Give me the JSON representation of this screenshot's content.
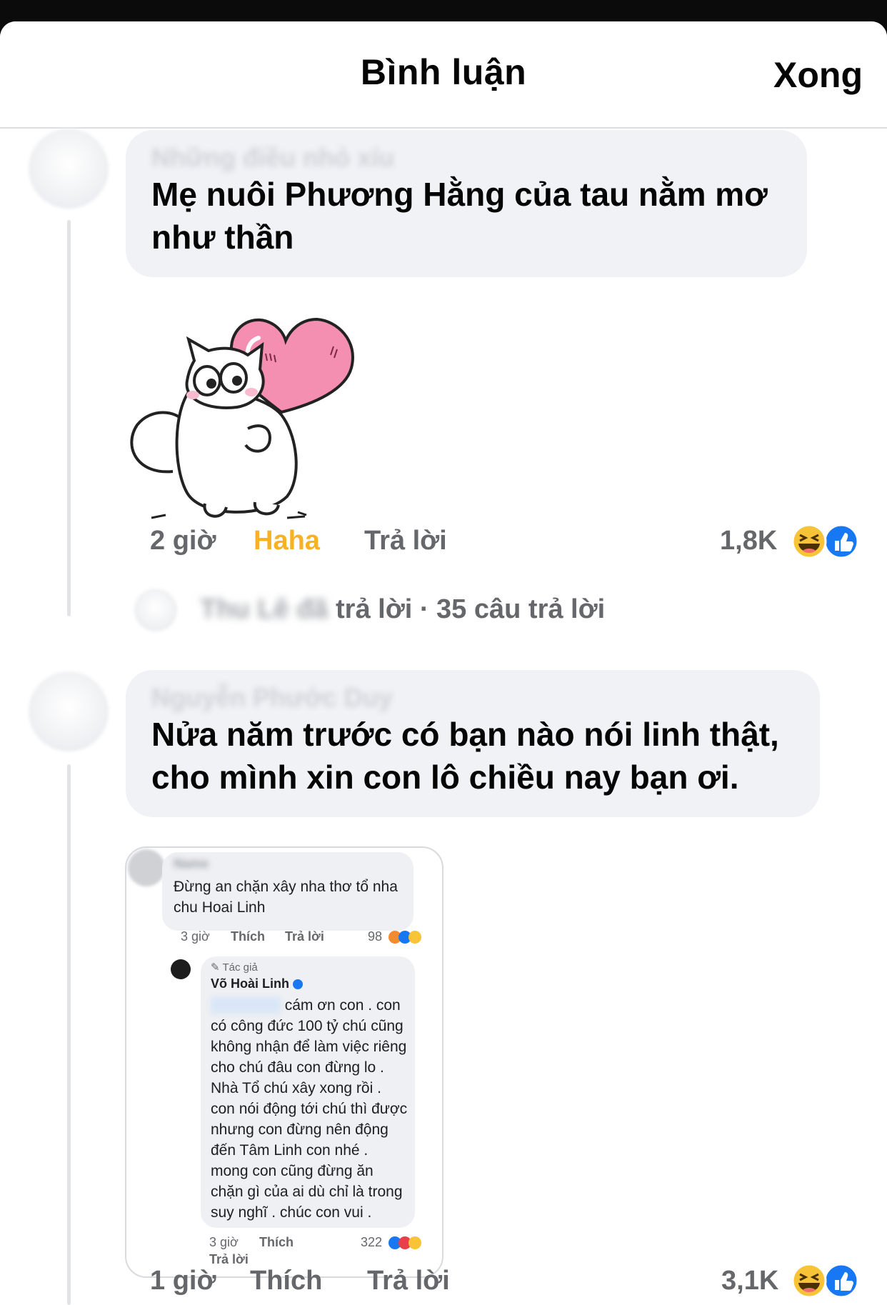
{
  "header": {
    "title": "Bình luận",
    "done_label": "Xong"
  },
  "comments": [
    {
      "author": "Những điều nhỏ xíu",
      "text": "Mẹ nuôi Phương Hằng của tau nằm mơ như thần",
      "time": "2 giờ",
      "reaction_label": "Haha",
      "reply_label": "Trả lời",
      "reaction_count": "1,8K",
      "reactions": [
        "haha-icon",
        "like-icon"
      ],
      "replies": {
        "blurred_prefix": "Thu Lê đã",
        "suffix": "trả lời · 35 câu trả lời"
      }
    },
    {
      "author": "Nguyễn Phước Duy",
      "text": "Nửa năm trước có bạn nào nói linh thật, cho mình xin con lô chiều nay bạn ơi.",
      "time": "1 giờ",
      "like_label": "Thích",
      "reply_label": "Trả lời",
      "reaction_count": "3,1K",
      "reactions": [
        "haha-icon",
        "like-icon"
      ],
      "attachment": {
        "comment": {
          "author": "Name",
          "text": "Đừng an chặn xây nha thơ tổ nha chu Hoai Linh",
          "time": "3 giờ",
          "like_label": "Thích",
          "reply_label": "Trả lời",
          "reaction_count": "98"
        },
        "reply": {
          "badge": "Tác giả",
          "author": "Võ Hoài Linh",
          "mention": "Tên người",
          "text": "cám ơn con . con có công đức 100 tỷ chú cũng không nhận để làm việc riêng cho chú đâu con đừng lo . Nhà Tổ chú xây xong rồi . con nói động tới chú thì được nhưng con đừng nên động đến Tâm Linh con nhé . mong con cũng đừng ăn chặn gì của ai dù chỉ là trong suy nghĩ . chúc con vui .",
          "time": "3 giờ",
          "like_label": "Thích",
          "reply_label": "Trả lời",
          "reaction_count": "322"
        }
      }
    }
  ],
  "colors": {
    "bubble": "#f0f2f5",
    "meta": "#65676b",
    "haha_active": "#f7b125",
    "like_blue": "#1877f2"
  }
}
